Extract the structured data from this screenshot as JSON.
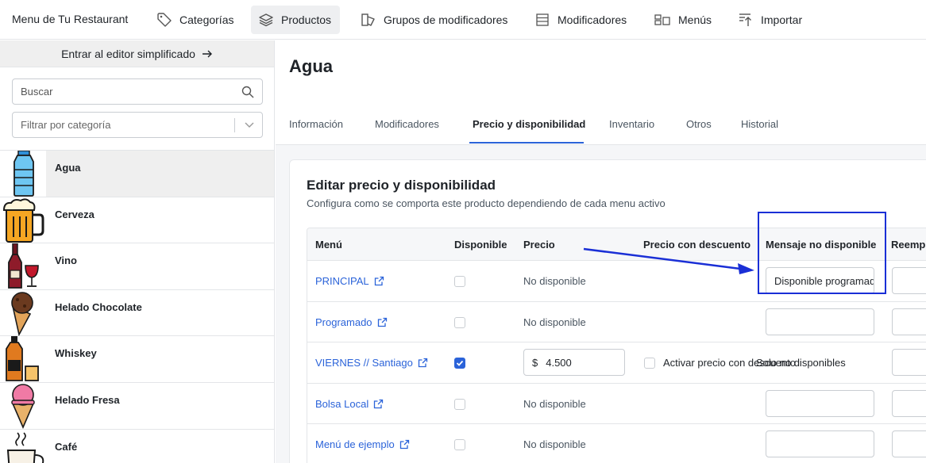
{
  "nav": {
    "brand": "Menu de Tu Restaurant",
    "items": [
      {
        "label": "Categorías",
        "icon": "tag-icon"
      },
      {
        "label": "Productos",
        "icon": "layers-icon",
        "active": true
      },
      {
        "label": "Grupos de modificadores",
        "icon": "group-icon"
      },
      {
        "label": "Modificadores",
        "icon": "list-icon"
      },
      {
        "label": "Menús",
        "icon": "menu-layout-icon"
      },
      {
        "label": "Importar",
        "icon": "import-icon"
      }
    ]
  },
  "sidebar": {
    "simplified_label": "Entrar al editor simplificado",
    "search_placeholder": "Buscar",
    "filter_placeholder": "Filtrar por categoría",
    "products": [
      {
        "name": "Agua",
        "icon": "water-bottle-icon",
        "selected": true
      },
      {
        "name": "Cerveza",
        "icon": "beer-mug-icon"
      },
      {
        "name": "Vino",
        "icon": "wine-icon"
      },
      {
        "name": "Helado Chocolate",
        "icon": "chocolate-ice-cream-icon"
      },
      {
        "name": "Whiskey",
        "icon": "whiskey-icon"
      },
      {
        "name": "Helado Fresa",
        "icon": "strawberry-ice-cream-icon"
      },
      {
        "name": "Café",
        "icon": "coffee-cup-icon"
      }
    ]
  },
  "main": {
    "title": "Agua",
    "tabs": [
      "Información",
      "Modificadores",
      "Precio y disponibilidad",
      "Inventario",
      "Otros",
      "Historial"
    ],
    "active_tab": "Precio y disponibilidad",
    "card": {
      "title": "Editar precio y disponibilidad",
      "subtitle": "Configura como se comporta este producto dependiendo de cada menu activo",
      "columns": [
        "Menú",
        "Disponible",
        "Precio",
        "Precio con descuento",
        "Mensaje no disponible",
        "Reempl"
      ],
      "rows": [
        {
          "menu": "PRINCIPAL",
          "available": false,
          "price_text": "No disponible",
          "message": "Disponible programado"
        },
        {
          "menu": "Programado",
          "available": false,
          "price_text": "No disponible",
          "message": ""
        },
        {
          "menu": "VIERNES // Santiago",
          "available": true,
          "currency": "$",
          "price": "4.500",
          "discount_label": "Activar precio con descuento",
          "overlap_label": "Solo no disponibles",
          "message": ""
        },
        {
          "menu": "Bolsa Local",
          "available": false,
          "price_text": "No disponible",
          "message": ""
        },
        {
          "menu": "Menú de ejemplo",
          "available": false,
          "price_text": "No disponible",
          "message": ""
        }
      ]
    }
  },
  "colors": {
    "accent": "#2b63d9",
    "highlight": "#1a2fd6",
    "selected_bg": "#efefef"
  }
}
